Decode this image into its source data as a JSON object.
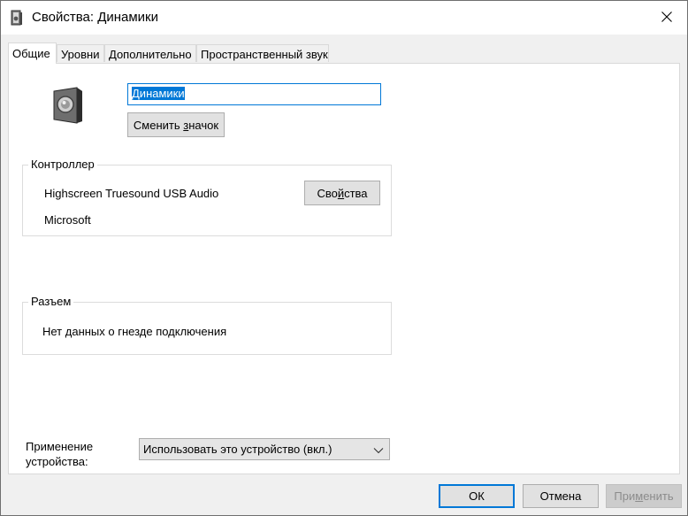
{
  "window": {
    "title": "Свойства: Динамики",
    "icon": "speaker-icon",
    "close_icon": "close-icon"
  },
  "tabs": [
    {
      "label": "Общие",
      "active": true
    },
    {
      "label": "Уровни",
      "active": false
    },
    {
      "label": "Дополнительно",
      "active": false
    },
    {
      "label": "Пространственный звук",
      "active": false
    }
  ],
  "general": {
    "device_name": "Динамики",
    "change_icon_pre": "Сменить ",
    "change_icon_underlined": "з",
    "change_icon_post": "начок",
    "controller": {
      "label": "Контроллер",
      "name": "Highscreen Truesound USB Audio",
      "vendor": "Microsoft",
      "properties_pre": "Сво",
      "properties_underlined": "й",
      "properties_post": "ства"
    },
    "jack": {
      "label": "Разъем",
      "info": "Нет данных о гнезде подключения"
    },
    "device_usage": {
      "label_line1": "Применение",
      "label_line2": "устройства:",
      "selected": "Использовать это устройство (вкл.)"
    }
  },
  "buttons": {
    "ok": "ОК",
    "cancel": "Отмена",
    "apply_pre": "При",
    "apply_underlined": "м",
    "apply_post": "енить",
    "apply_enabled": false
  },
  "colors": {
    "accent": "#0078d7",
    "panel_bg": "#ffffff",
    "window_bg": "#f0f0f0"
  }
}
